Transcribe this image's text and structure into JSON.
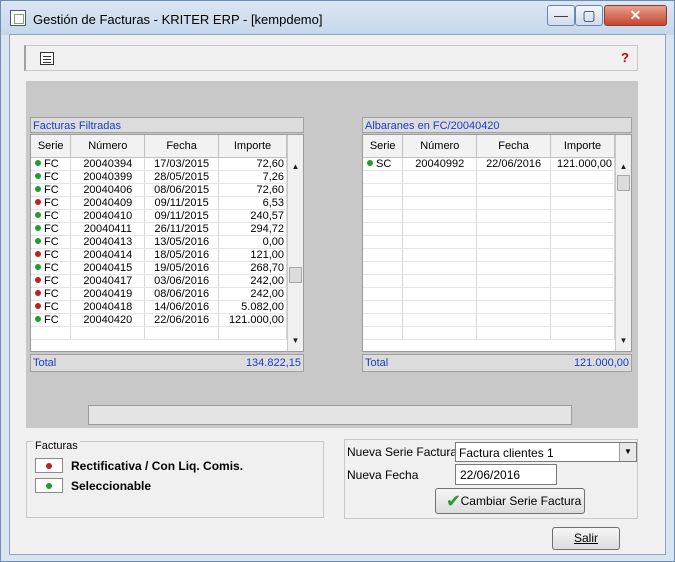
{
  "window": {
    "title": "Gestión de Facturas - KRITER ERP - [kempdemo]"
  },
  "window_controls": {
    "minimize": "—",
    "maximize": "▢",
    "close": "✕"
  },
  "toolbar": {
    "help": "?"
  },
  "left_grid": {
    "caption": "Facturas Filtradas",
    "columns": [
      "Serie",
      "Número",
      "Fecha",
      "Importe"
    ],
    "rows": [
      {
        "status": "green",
        "serie": "FC",
        "numero": "20040394",
        "fecha": "17/03/2015",
        "importe": "72,60"
      },
      {
        "status": "green",
        "serie": "FC",
        "numero": "20040399",
        "fecha": "28/05/2015",
        "importe": "7,26"
      },
      {
        "status": "green",
        "serie": "FC",
        "numero": "20040406",
        "fecha": "08/06/2015",
        "importe": "72,60"
      },
      {
        "status": "red",
        "serie": "FC",
        "numero": "20040409",
        "fecha": "09/11/2015",
        "importe": "6,53"
      },
      {
        "status": "green",
        "serie": "FC",
        "numero": "20040410",
        "fecha": "09/11/2015",
        "importe": "240,57"
      },
      {
        "status": "green",
        "serie": "FC",
        "numero": "20040411",
        "fecha": "26/11/2015",
        "importe": "294,72"
      },
      {
        "status": "green",
        "serie": "FC",
        "numero": "20040413",
        "fecha": "13/05/2016",
        "importe": "0,00"
      },
      {
        "status": "red",
        "serie": "FC",
        "numero": "20040414",
        "fecha": "18/05/2016",
        "importe": "121,00"
      },
      {
        "status": "green",
        "serie": "FC",
        "numero": "20040415",
        "fecha": "19/05/2016",
        "importe": "268,70"
      },
      {
        "status": "red",
        "serie": "FC",
        "numero": "20040417",
        "fecha": "03/06/2016",
        "importe": "242,00"
      },
      {
        "status": "red",
        "serie": "FC",
        "numero": "20040419",
        "fecha": "08/06/2016",
        "importe": "242,00"
      },
      {
        "status": "red",
        "serie": "FC",
        "numero": "20040418",
        "fecha": "14/06/2016",
        "importe": "5.082,00"
      },
      {
        "status": "green",
        "serie": "FC",
        "numero": "20040420",
        "fecha": "22/06/2016",
        "importe": "121.000,00"
      }
    ],
    "total_label": "Total",
    "total_value": "134.822,15"
  },
  "right_grid": {
    "caption": "Albaranes en FC/20040420",
    "columns": [
      "Serie",
      "Número",
      "Fecha",
      "Importe"
    ],
    "rows": [
      {
        "status": "green",
        "serie": "SC",
        "numero": "20040992",
        "fecha": "22/06/2016",
        "importe": "121.000,00"
      }
    ],
    "total_label": "Total",
    "total_value": "121.000,00"
  },
  "legend": {
    "title": "Facturas",
    "items": [
      {
        "status": "red",
        "label": "Rectificativa / Con Liq. Comis."
      },
      {
        "status": "green",
        "label": "Seleccionable"
      }
    ]
  },
  "form": {
    "serie_label": "Nueva Serie Factura",
    "serie_value": "Factura clientes 1",
    "fecha_label": "Nueva Fecha",
    "fecha_value": "22/06/2016",
    "change_button": "Cambiar Serie Factura"
  },
  "footer": {
    "exit_button": "Salir"
  }
}
